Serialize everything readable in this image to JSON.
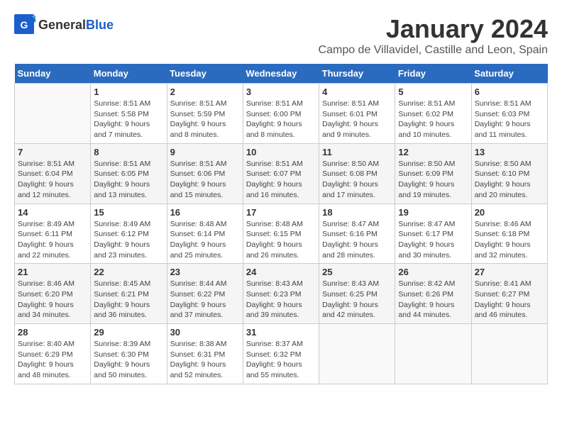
{
  "header": {
    "logo_general": "General",
    "logo_blue": "Blue",
    "title": "January 2024",
    "subtitle": "Campo de Villavidel, Castille and Leon, Spain"
  },
  "days_of_week": [
    "Sunday",
    "Monday",
    "Tuesday",
    "Wednesday",
    "Thursday",
    "Friday",
    "Saturday"
  ],
  "weeks": [
    [
      {
        "day": "",
        "info": ""
      },
      {
        "day": "1",
        "info": "Sunrise: 8:51 AM\nSunset: 5:58 PM\nDaylight: 9 hours\nand 7 minutes."
      },
      {
        "day": "2",
        "info": "Sunrise: 8:51 AM\nSunset: 5:59 PM\nDaylight: 9 hours\nand 8 minutes."
      },
      {
        "day": "3",
        "info": "Sunrise: 8:51 AM\nSunset: 6:00 PM\nDaylight: 9 hours\nand 8 minutes."
      },
      {
        "day": "4",
        "info": "Sunrise: 8:51 AM\nSunset: 6:01 PM\nDaylight: 9 hours\nand 9 minutes."
      },
      {
        "day": "5",
        "info": "Sunrise: 8:51 AM\nSunset: 6:02 PM\nDaylight: 9 hours\nand 10 minutes."
      },
      {
        "day": "6",
        "info": "Sunrise: 8:51 AM\nSunset: 6:03 PM\nDaylight: 9 hours\nand 11 minutes."
      }
    ],
    [
      {
        "day": "7",
        "info": "Sunrise: 8:51 AM\nSunset: 6:04 PM\nDaylight: 9 hours\nand 12 minutes."
      },
      {
        "day": "8",
        "info": "Sunrise: 8:51 AM\nSunset: 6:05 PM\nDaylight: 9 hours\nand 13 minutes."
      },
      {
        "day": "9",
        "info": "Sunrise: 8:51 AM\nSunset: 6:06 PM\nDaylight: 9 hours\nand 15 minutes."
      },
      {
        "day": "10",
        "info": "Sunrise: 8:51 AM\nSunset: 6:07 PM\nDaylight: 9 hours\nand 16 minutes."
      },
      {
        "day": "11",
        "info": "Sunrise: 8:50 AM\nSunset: 6:08 PM\nDaylight: 9 hours\nand 17 minutes."
      },
      {
        "day": "12",
        "info": "Sunrise: 8:50 AM\nSunset: 6:09 PM\nDaylight: 9 hours\nand 19 minutes."
      },
      {
        "day": "13",
        "info": "Sunrise: 8:50 AM\nSunset: 6:10 PM\nDaylight: 9 hours\nand 20 minutes."
      }
    ],
    [
      {
        "day": "14",
        "info": "Sunrise: 8:49 AM\nSunset: 6:11 PM\nDaylight: 9 hours\nand 22 minutes."
      },
      {
        "day": "15",
        "info": "Sunrise: 8:49 AM\nSunset: 6:12 PM\nDaylight: 9 hours\nand 23 minutes."
      },
      {
        "day": "16",
        "info": "Sunrise: 8:48 AM\nSunset: 6:14 PM\nDaylight: 9 hours\nand 25 minutes."
      },
      {
        "day": "17",
        "info": "Sunrise: 8:48 AM\nSunset: 6:15 PM\nDaylight: 9 hours\nand 26 minutes."
      },
      {
        "day": "18",
        "info": "Sunrise: 8:47 AM\nSunset: 6:16 PM\nDaylight: 9 hours\nand 28 minutes."
      },
      {
        "day": "19",
        "info": "Sunrise: 8:47 AM\nSunset: 6:17 PM\nDaylight: 9 hours\nand 30 minutes."
      },
      {
        "day": "20",
        "info": "Sunrise: 8:46 AM\nSunset: 6:18 PM\nDaylight: 9 hours\nand 32 minutes."
      }
    ],
    [
      {
        "day": "21",
        "info": "Sunrise: 8:46 AM\nSunset: 6:20 PM\nDaylight: 9 hours\nand 34 minutes."
      },
      {
        "day": "22",
        "info": "Sunrise: 8:45 AM\nSunset: 6:21 PM\nDaylight: 9 hours\nand 36 minutes."
      },
      {
        "day": "23",
        "info": "Sunrise: 8:44 AM\nSunset: 6:22 PM\nDaylight: 9 hours\nand 37 minutes."
      },
      {
        "day": "24",
        "info": "Sunrise: 8:43 AM\nSunset: 6:23 PM\nDaylight: 9 hours\nand 39 minutes."
      },
      {
        "day": "25",
        "info": "Sunrise: 8:43 AM\nSunset: 6:25 PM\nDaylight: 9 hours\nand 42 minutes."
      },
      {
        "day": "26",
        "info": "Sunrise: 8:42 AM\nSunset: 6:26 PM\nDaylight: 9 hours\nand 44 minutes."
      },
      {
        "day": "27",
        "info": "Sunrise: 8:41 AM\nSunset: 6:27 PM\nDaylight: 9 hours\nand 46 minutes."
      }
    ],
    [
      {
        "day": "28",
        "info": "Sunrise: 8:40 AM\nSunset: 6:29 PM\nDaylight: 9 hours\nand 48 minutes."
      },
      {
        "day": "29",
        "info": "Sunrise: 8:39 AM\nSunset: 6:30 PM\nDaylight: 9 hours\nand 50 minutes."
      },
      {
        "day": "30",
        "info": "Sunrise: 8:38 AM\nSunset: 6:31 PM\nDaylight: 9 hours\nand 52 minutes."
      },
      {
        "day": "31",
        "info": "Sunrise: 8:37 AM\nSunset: 6:32 PM\nDaylight: 9 hours\nand 55 minutes."
      },
      {
        "day": "",
        "info": ""
      },
      {
        "day": "",
        "info": ""
      },
      {
        "day": "",
        "info": ""
      }
    ]
  ]
}
